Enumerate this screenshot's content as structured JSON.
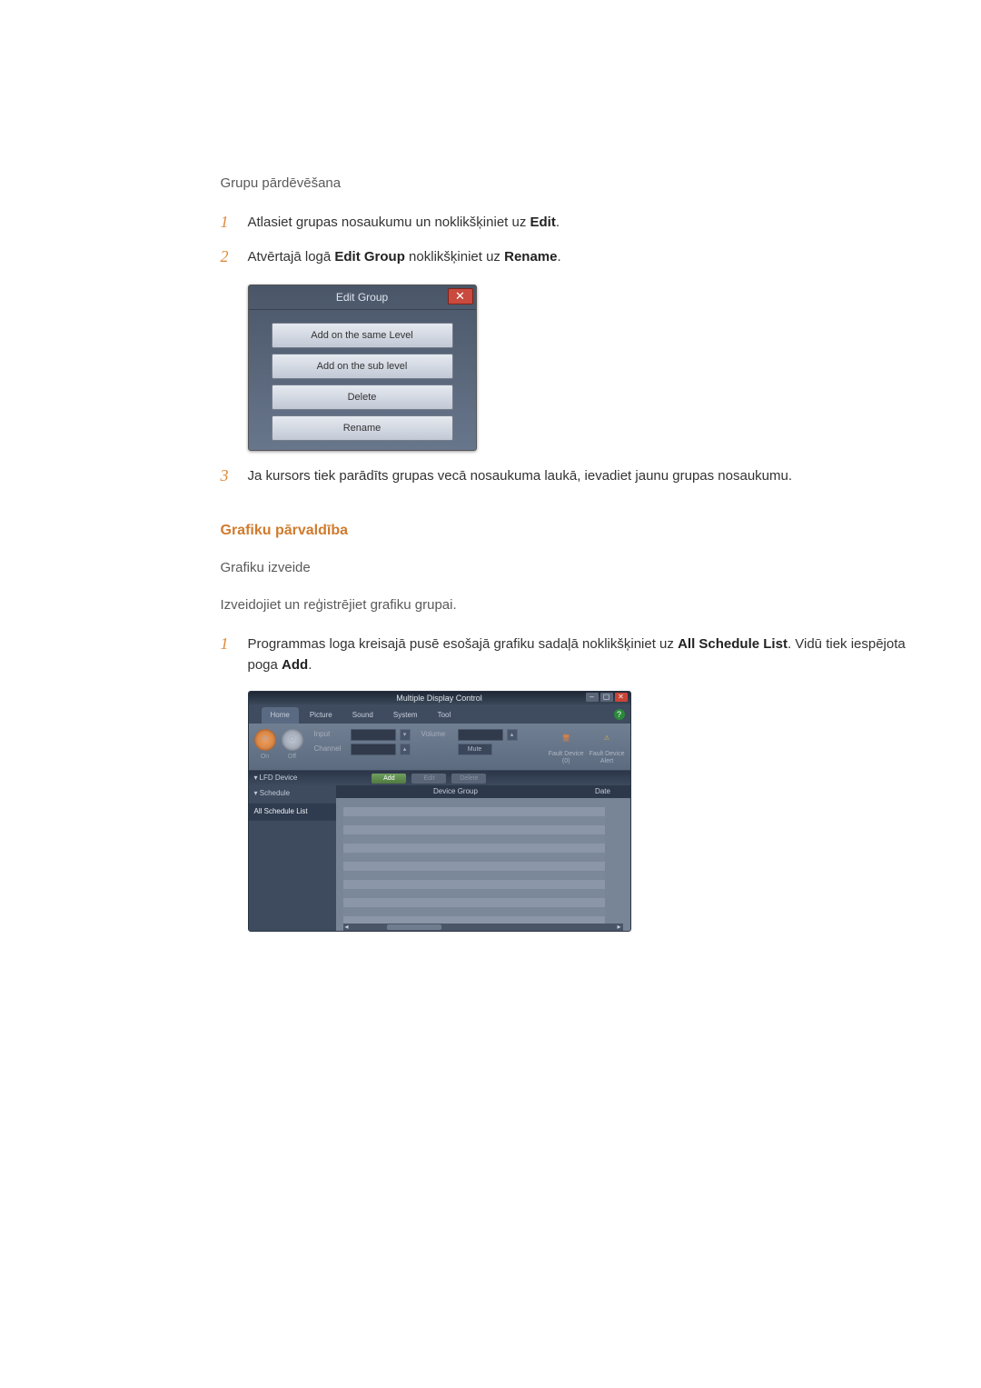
{
  "sec1_title": "Grupu pārdēvēšana",
  "step1": {
    "pre": "Atlasiet grupas nosaukumu un noklikšķiniet uz ",
    "b": "Edit",
    "post": "."
  },
  "step2": {
    "pre": "Atvērtajā logā ",
    "b1": "Edit Group",
    "mid": " noklikšķiniet uz ",
    "b2": "Rename",
    "post": "."
  },
  "fig1": {
    "title": "Edit Group",
    "btn1": "Add on the same Level",
    "btn2": "Add on the sub level",
    "btn3": "Delete",
    "btn4": "Rename"
  },
  "step3": "Ja kursors tiek parādīts grupas vecā nosaukuma laukā, ievadiet jaunu grupas nosaukumu.",
  "h_orange": "Grafiku pārvaldība",
  "sec2_sub": "Grafiku izveide",
  "p_intro": "Izveidojiet un reģistrējiet grafiku grupai.",
  "step_a": {
    "pre": "Programmas loga kreisajā pusē esošajā grafiku sadaļā noklikšķiniet uz ",
    "b1": "All Schedule List",
    "mid": ". Vidū tiek iespējota poga ",
    "b2": "Add",
    "post": "."
  },
  "fig2": {
    "title": "Multiple Display Control",
    "tabs": [
      "Home",
      "Picture",
      "Sound",
      "System",
      "Tool"
    ],
    "power_on": "On",
    "power_off": "Off",
    "input_label": "Input",
    "channel_label": "Channel",
    "volume_label": "Volume",
    "mute_label": "Mute",
    "fault1_l1": "Fault Device",
    "fault1_l2": "(0)",
    "fault2_l1": "Fault Device",
    "fault2_l2": "Alert",
    "side_top": "LFD Device",
    "btn_add": "Add",
    "btn_edit": "Edit",
    "btn_delete": "Delete",
    "side_sched": "Schedule",
    "side_all": "All Schedule List",
    "col1": "Device Group",
    "col2": "Date"
  }
}
